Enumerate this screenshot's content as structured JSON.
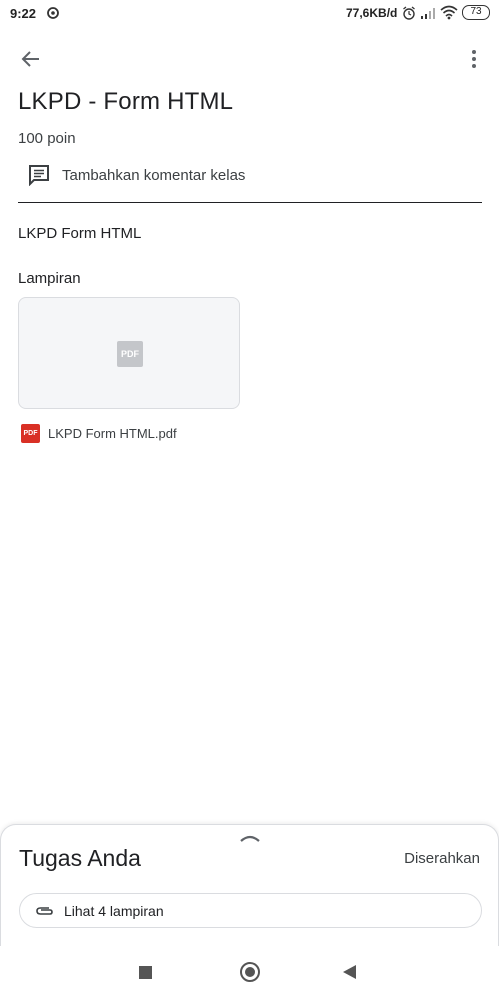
{
  "status_bar": {
    "time": "9:22",
    "net_speed": "77,6KB/d",
    "battery": "73"
  },
  "header": {
    "title": "LKPD - Form HTML",
    "points": "100 poin",
    "back_icon": "arrow-back-icon",
    "more_icon": "more-vert-icon"
  },
  "comment": {
    "label": "Tambahkan komentar kelas",
    "icon": "comment-icon"
  },
  "description": "LKPD Form HTML",
  "attachments": {
    "heading": "Lampiran",
    "thumb_badge": "PDF",
    "file_badge": "PDF",
    "file_name": "LKPD Form HTML.pdf"
  },
  "bottom_sheet": {
    "title": "Tugas Anda",
    "status": "Diserahkan",
    "view_attachments": "Lihat 4 lampiran",
    "handle_icon": "chevron-up-icon",
    "clip_icon": "paperclip-icon"
  },
  "colors": {
    "pdf_red": "#d93025",
    "text": "#202124",
    "border": "#dadce0"
  }
}
